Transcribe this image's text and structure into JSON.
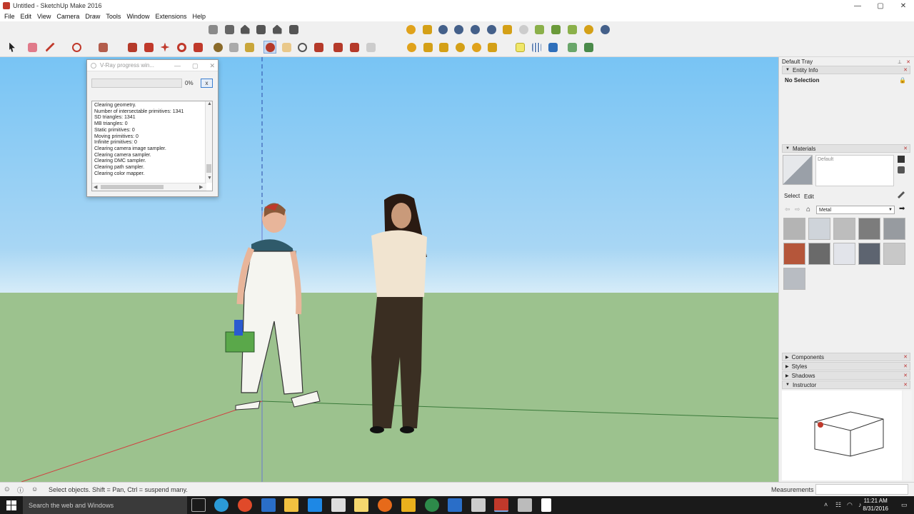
{
  "window": {
    "title": "Untitled - SketchUp Make 2016",
    "controls": [
      "—",
      "▢",
      "✕"
    ]
  },
  "menu": [
    "File",
    "Edit",
    "View",
    "Camera",
    "Draw",
    "Tools",
    "Window",
    "Extensions",
    "Help"
  ],
  "vray_dialog": {
    "title": "V-Ray progress win...",
    "progress": 0,
    "progress_label": "0%",
    "cancel_label": "x",
    "log": [
      "Clearing geometry.",
      "Number of intersectable primitives: 1341",
      "SD triangles: 1341",
      "MB triangles: 0",
      "Static primitives: 0",
      "Moving primitives: 0",
      "Infinite primitives: 0",
      "Clearing camera image sampler.",
      "Clearing camera sampler.",
      "Clearing DMC sampler.",
      "Clearing path sampler.",
      "Clearing color mapper."
    ]
  },
  "tray": {
    "title": "Default Tray",
    "entity_info": {
      "header": "Entity Info",
      "selection": "No Selection"
    },
    "materials": {
      "header": "Materials",
      "current": "Default",
      "tabs": [
        "Select",
        "Edit"
      ],
      "collection": "Metal",
      "swatches": [
        "#b4b4b4",
        "#cfd4da",
        "#bdbdbd",
        "#7c7c7c",
        "#979ba0",
        "#b5563a",
        "#6a6a6a",
        "#e2e4ea",
        "#5d6470",
        "#c8c8c8",
        "#b8bcc2"
      ]
    },
    "collapsed_panels": [
      "Components",
      "Styles",
      "Shadows"
    ],
    "instructor": {
      "header": "Instructor"
    }
  },
  "statusbar": {
    "hint": "Select objects. Shift = Pan, Ctrl = suspend many.",
    "measurements_label": "Measurements"
  },
  "taskbar": {
    "search_placeholder": "Search the web and Windows",
    "time": "11:21 AM",
    "date": "8/31/2016"
  }
}
